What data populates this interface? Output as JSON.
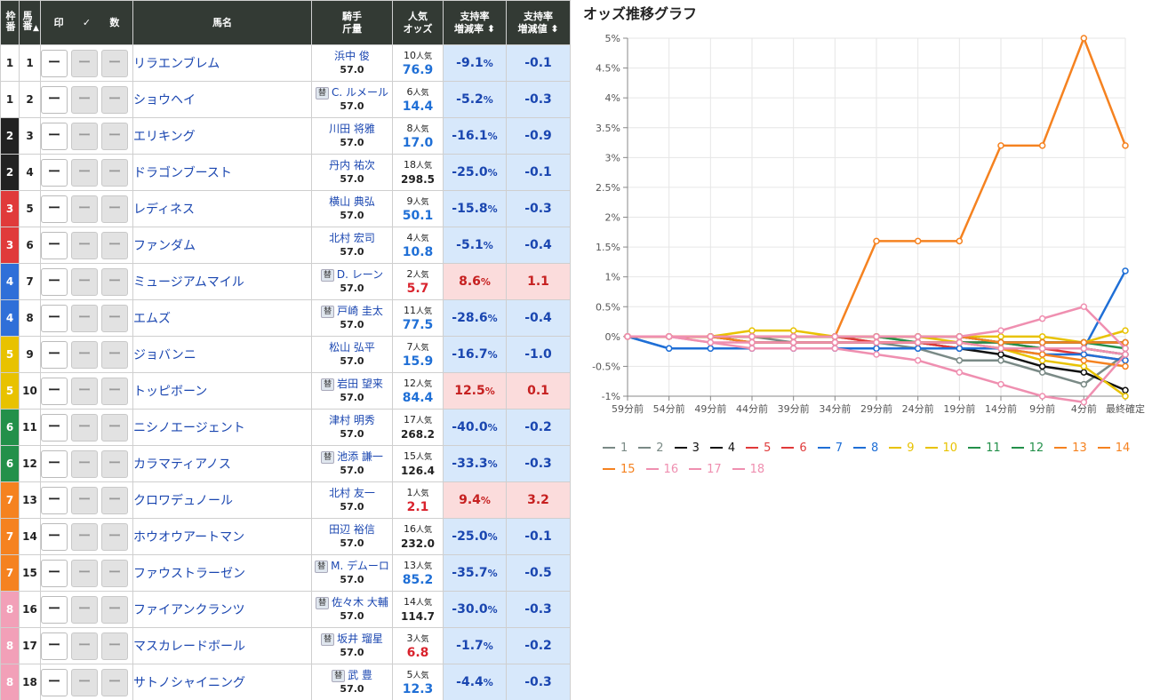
{
  "table": {
    "headers": {
      "waku": "枠番",
      "umaban": "馬番",
      "sort_mark": "▲",
      "mark": "印",
      "check": "✓",
      "count": "数",
      "name": "馬名",
      "jockey": "騎手",
      "kinryo": "斤量",
      "ninki": "人気",
      "odds": "オッズ",
      "rate_top": "支持率",
      "rate_bottom": "増減率",
      "value_top": "支持率",
      "value_bottom": "増減値",
      "sort_both": "⬍"
    },
    "mark_blank": "ー",
    "sub_label": "替",
    "ninki_suffix": "人気",
    "rows": [
      {
        "waku": "1",
        "uma": "1",
        "name": "リラエンブレム",
        "sub": false,
        "jockey": "浜中 俊",
        "weight": "57.0",
        "pop": "10",
        "odds": "76.9",
        "oddscolor": "blue",
        "rate": "-9.1",
        "value": "-0.1",
        "dir": "dn"
      },
      {
        "waku": "1",
        "uma": "2",
        "name": "ショウヘイ",
        "sub": true,
        "jockey": "C. ルメール",
        "weight": "57.0",
        "pop": "6",
        "odds": "14.4",
        "oddscolor": "blue",
        "rate": "-5.2",
        "value": "-0.3",
        "dir": "dn"
      },
      {
        "waku": "2",
        "uma": "3",
        "name": "エリキング",
        "sub": false,
        "jockey": "川田 将雅",
        "weight": "57.0",
        "pop": "8",
        "odds": "17.0",
        "oddscolor": "blue",
        "rate": "-16.1",
        "value": "-0.9",
        "dir": "dn"
      },
      {
        "waku": "2",
        "uma": "4",
        "name": "ドラゴンブースト",
        "sub": false,
        "jockey": "丹内 祐次",
        "weight": "57.0",
        "pop": "18",
        "odds": "298.5",
        "oddscolor": "dark",
        "rate": "-25.0",
        "value": "-0.1",
        "dir": "dn"
      },
      {
        "waku": "3",
        "uma": "5",
        "name": "レディネス",
        "sub": false,
        "jockey": "横山 典弘",
        "weight": "57.0",
        "pop": "9",
        "odds": "50.1",
        "oddscolor": "blue",
        "rate": "-15.8",
        "value": "-0.3",
        "dir": "dn"
      },
      {
        "waku": "3",
        "uma": "6",
        "name": "ファンダム",
        "sub": false,
        "jockey": "北村 宏司",
        "weight": "57.0",
        "pop": "4",
        "odds": "10.8",
        "oddscolor": "blue",
        "rate": "-5.1",
        "value": "-0.4",
        "dir": "dn"
      },
      {
        "waku": "4",
        "uma": "7",
        "name": "ミュージアムマイル",
        "sub": true,
        "jockey": "D. レーン",
        "weight": "57.0",
        "pop": "2",
        "odds": "5.7",
        "oddscolor": "red",
        "rate": "8.6",
        "value": "1.1",
        "dir": "up"
      },
      {
        "waku": "4",
        "uma": "8",
        "name": "エムズ",
        "sub": true,
        "jockey": "戸崎 圭太",
        "weight": "57.0",
        "pop": "11",
        "odds": "77.5",
        "oddscolor": "blue",
        "rate": "-28.6",
        "value": "-0.4",
        "dir": "dn"
      },
      {
        "waku": "5",
        "uma": "9",
        "name": "ジョバンニ",
        "sub": false,
        "jockey": "松山 弘平",
        "weight": "57.0",
        "pop": "7",
        "odds": "15.9",
        "oddscolor": "blue",
        "rate": "-16.7",
        "value": "-1.0",
        "dir": "dn"
      },
      {
        "waku": "5",
        "uma": "10",
        "name": "トッピボーン",
        "sub": true,
        "jockey": "岩田 望来",
        "weight": "57.0",
        "pop": "12",
        "odds": "84.4",
        "oddscolor": "blue",
        "rate": "12.5",
        "value": "0.1",
        "dir": "up"
      },
      {
        "waku": "6",
        "uma": "11",
        "name": "ニシノエージェント",
        "sub": false,
        "jockey": "津村 明秀",
        "weight": "57.0",
        "pop": "17",
        "odds": "268.2",
        "oddscolor": "dark",
        "rate": "-40.0",
        "value": "-0.2",
        "dir": "dn"
      },
      {
        "waku": "6",
        "uma": "12",
        "name": "カラマティアノス",
        "sub": true,
        "jockey": "池添 謙一",
        "weight": "57.0",
        "pop": "15",
        "odds": "126.4",
        "oddscolor": "dark",
        "rate": "-33.3",
        "value": "-0.3",
        "dir": "dn"
      },
      {
        "waku": "7",
        "uma": "13",
        "name": "クロワデュノール",
        "sub": false,
        "jockey": "北村 友一",
        "weight": "57.0",
        "pop": "1",
        "odds": "2.1",
        "oddscolor": "red",
        "rate": "9.4",
        "value": "3.2",
        "dir": "up"
      },
      {
        "waku": "7",
        "uma": "14",
        "name": "ホウオウアートマン",
        "sub": false,
        "jockey": "田辺 裕信",
        "weight": "57.0",
        "pop": "16",
        "odds": "232.0",
        "oddscolor": "dark",
        "rate": "-25.0",
        "value": "-0.1",
        "dir": "dn"
      },
      {
        "waku": "7",
        "uma": "15",
        "name": "ファウストラーゼン",
        "sub": true,
        "jockey": "M. デムーロ",
        "weight": "57.0",
        "pop": "13",
        "odds": "85.2",
        "oddscolor": "blue",
        "rate": "-35.7",
        "value": "-0.5",
        "dir": "dn"
      },
      {
        "waku": "8",
        "uma": "16",
        "name": "ファイアンクランツ",
        "sub": true,
        "jockey": "佐々木 大輔",
        "weight": "57.0",
        "pop": "14",
        "odds": "114.7",
        "oddscolor": "dark",
        "rate": "-30.0",
        "value": "-0.3",
        "dir": "dn"
      },
      {
        "waku": "8",
        "uma": "17",
        "name": "マスカレードボール",
        "sub": true,
        "jockey": "坂井 瑠星",
        "weight": "57.0",
        "pop": "3",
        "odds": "6.8",
        "oddscolor": "red",
        "rate": "-1.7",
        "value": "-0.2",
        "dir": "dn"
      },
      {
        "waku": "8",
        "uma": "18",
        "name": "サトノシャイニング",
        "sub": true,
        "jockey": "武 豊",
        "weight": "57.0",
        "pop": "5",
        "odds": "12.3",
        "oddscolor": "blue",
        "rate": "-4.4",
        "value": "-0.3",
        "dir": "dn"
      }
    ]
  },
  "waku_colors": {
    "1": {
      "bg": "#ffffff",
      "fg": "#222222"
    },
    "2": {
      "bg": "#222222",
      "fg": "#ffffff"
    },
    "3": {
      "bg": "#e03a3a",
      "fg": "#ffffff"
    },
    "4": {
      "bg": "#2f6fd8",
      "fg": "#ffffff"
    },
    "5": {
      "bg": "#e8c200",
      "fg": "#ffffff"
    },
    "6": {
      "bg": "#23904a",
      "fg": "#ffffff"
    },
    "7": {
      "bg": "#f58220",
      "fg": "#ffffff"
    },
    "8": {
      "bg": "#f2a0b8",
      "fg": "#ffffff"
    }
  },
  "chart_title": "オッズ推移グラフ",
  "chart_data": {
    "type": "line",
    "title": "オッズ推移グラフ",
    "x": [
      "59分前",
      "54分前",
      "49分前",
      "44分前",
      "39分前",
      "34分前",
      "29分前",
      "24分前",
      "19分前",
      "14分前",
      "9分前",
      "4分前",
      "最終確定"
    ],
    "y_ticks": [
      "5%",
      "4.5%",
      "4%",
      "3.5%",
      "3%",
      "2.5%",
      "2%",
      "1.5%",
      "1%",
      "0.5%",
      "0%",
      "-0.5%",
      "-1%"
    ],
    "ylim": [
      -1,
      5
    ],
    "grid": true,
    "legend_position": "bottom",
    "series": [
      {
        "name": "1",
        "color": "#7a8a86",
        "values": [
          0,
          0,
          0,
          0,
          0,
          0,
          0,
          -0.1,
          -0.1,
          -0.1,
          -0.1,
          -0.1,
          -0.1
        ]
      },
      {
        "name": "2",
        "color": "#7a8a86",
        "values": [
          0,
          0,
          0,
          0,
          -0.1,
          -0.1,
          -0.1,
          -0.2,
          -0.4,
          -0.4,
          -0.6,
          -0.8,
          -0.3
        ]
      },
      {
        "name": "3",
        "color": "#111111",
        "values": [
          0,
          0,
          0,
          -0.1,
          -0.1,
          -0.1,
          -0.1,
          -0.1,
          -0.2,
          -0.3,
          -0.5,
          -0.6,
          -0.9
        ]
      },
      {
        "name": "4",
        "color": "#111111",
        "values": [
          0,
          0,
          0,
          0,
          0,
          0,
          0,
          0,
          0,
          -0.1,
          -0.1,
          -0.1,
          -0.1
        ]
      },
      {
        "name": "5",
        "color": "#e03a3a",
        "values": [
          0,
          0,
          0,
          0,
          0,
          0,
          -0.1,
          -0.1,
          -0.1,
          -0.1,
          -0.2,
          -0.2,
          -0.3
        ]
      },
      {
        "name": "6",
        "color": "#e03a3a",
        "values": [
          0,
          0,
          0,
          0,
          0,
          0,
          -0.1,
          -0.1,
          -0.2,
          -0.2,
          -0.2,
          -0.3,
          -0.4
        ]
      },
      {
        "name": "7",
        "color": "#1f6fd6",
        "values": [
          0,
          -0.2,
          -0.2,
          -0.2,
          -0.2,
          -0.2,
          -0.2,
          -0.2,
          -0.2,
          -0.2,
          -0.2,
          -0.2,
          1.1
        ]
      },
      {
        "name": "8",
        "color": "#1f6fd6",
        "values": [
          0,
          -0.2,
          -0.2,
          -0.2,
          -0.2,
          -0.2,
          -0.2,
          -0.2,
          -0.2,
          -0.2,
          -0.3,
          -0.3,
          -0.4
        ]
      },
      {
        "name": "9",
        "color": "#e8c200",
        "values": [
          0,
          0,
          0,
          0,
          0,
          0,
          0,
          0,
          -0.1,
          -0.2,
          -0.4,
          -0.5,
          -1.0
        ]
      },
      {
        "name": "10",
        "color": "#e8c200",
        "values": [
          0,
          0,
          0,
          0.1,
          0.1,
          0,
          0,
          0,
          0,
          0,
          0,
          -0.1,
          0.1
        ]
      },
      {
        "name": "11",
        "color": "#23904a",
        "values": [
          0,
          0,
          0,
          0,
          0,
          0,
          0,
          0,
          0,
          -0.1,
          -0.1,
          -0.1,
          -0.2
        ]
      },
      {
        "name": "12",
        "color": "#23904a",
        "values": [
          0,
          0,
          0,
          0,
          0,
          0,
          0,
          -0.1,
          -0.1,
          -0.1,
          -0.2,
          -0.2,
          -0.3
        ]
      },
      {
        "name": "13",
        "color": "#f58220",
        "values": [
          0,
          0,
          0,
          0,
          0,
          0,
          1.6,
          1.6,
          1.6,
          3.2,
          3.2,
          5.0,
          3.2
        ]
      },
      {
        "name": "14",
        "color": "#f58220",
        "values": [
          0,
          0,
          0,
          0,
          0,
          0,
          0,
          0,
          0,
          -0.1,
          -0.1,
          -0.1,
          -0.1
        ]
      },
      {
        "name": "15",
        "color": "#f58220",
        "values": [
          0,
          0,
          0,
          -0.1,
          -0.1,
          -0.1,
          -0.1,
          -0.1,
          -0.1,
          -0.2,
          -0.3,
          -0.4,
          -0.5
        ]
      },
      {
        "name": "16",
        "color": "#ef8fb0",
        "values": [
          0,
          0,
          -0.1,
          -0.1,
          -0.1,
          -0.1,
          -0.1,
          -0.1,
          -0.1,
          -0.2,
          -0.2,
          -0.2,
          -0.3
        ]
      },
      {
        "name": "17",
        "color": "#ef8fb0",
        "values": [
          0,
          0,
          0,
          0,
          0,
          0,
          0,
          0,
          0,
          0.1,
          0.3,
          0.5,
          -0.2
        ]
      },
      {
        "name": "18",
        "color": "#ef8fb0",
        "values": [
          0,
          0,
          -0.1,
          -0.2,
          -0.2,
          -0.2,
          -0.3,
          -0.4,
          -0.6,
          -0.8,
          -1.0,
          -1.1,
          -0.3
        ]
      }
    ]
  }
}
